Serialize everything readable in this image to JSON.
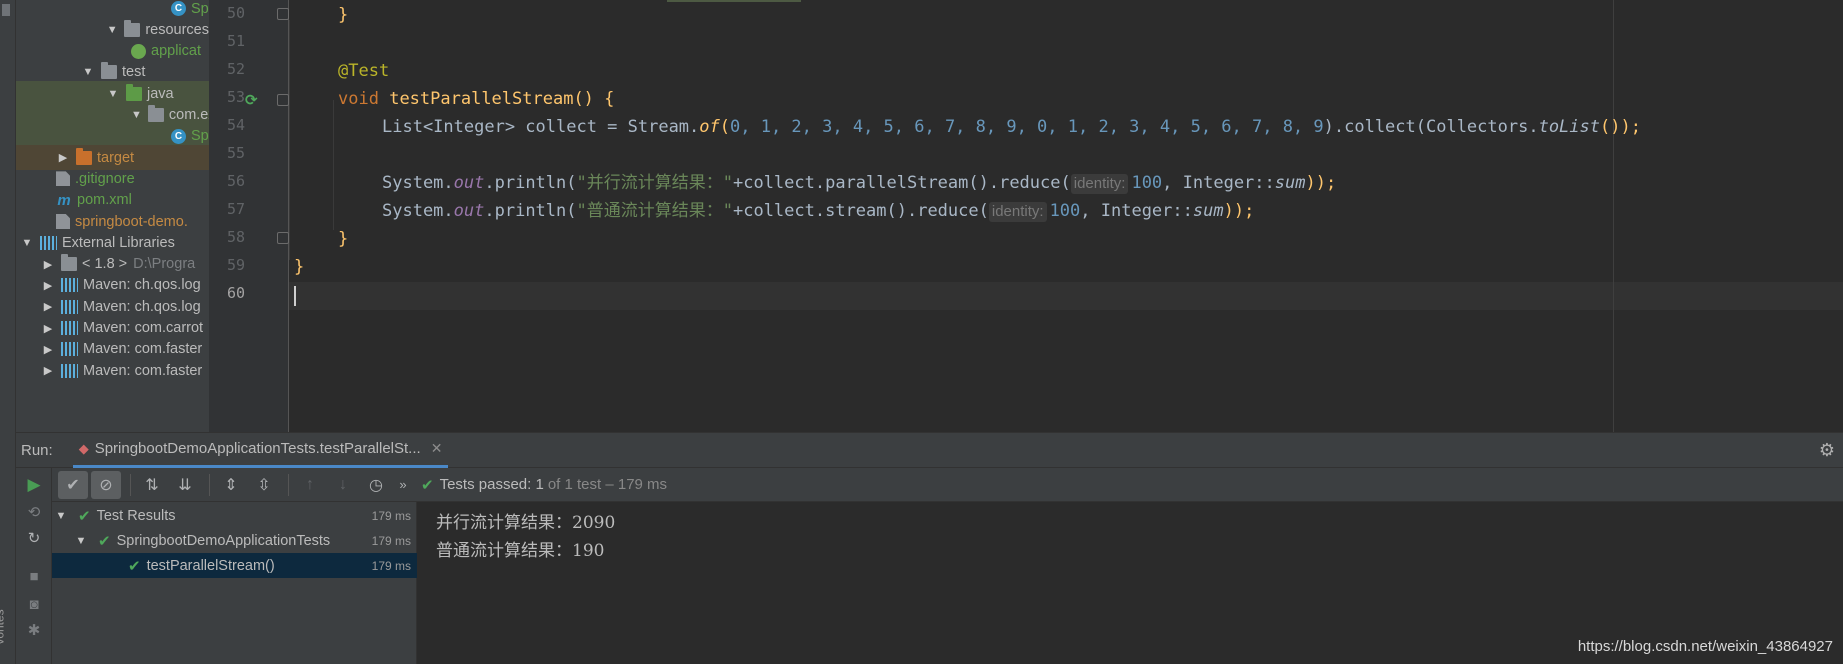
{
  "left_strip": {
    "favorites_label": "vorites"
  },
  "project_tree": [
    {
      "label": "Sprin",
      "icon": "spring-class-icon",
      "indent": 155,
      "color": "green"
    },
    {
      "label": "resources",
      "icon": "folder-icon",
      "indent": 90,
      "expanded": true
    },
    {
      "label": "applicat",
      "icon": "spring-config-icon",
      "indent": 115,
      "color": "green"
    },
    {
      "label": "test",
      "icon": "folder-icon",
      "indent": 65,
      "expanded": true
    },
    {
      "label": "java",
      "icon": "folder-icon",
      "indent": 90,
      "expanded": true,
      "highlight": "green"
    },
    {
      "label": "com.exa",
      "icon": "package-icon",
      "indent": 115,
      "expanded": true,
      "highlight": "green"
    },
    {
      "label": "Sprin",
      "icon": "spring-class-icon",
      "indent": 155,
      "color": "green",
      "highlight": "green"
    },
    {
      "label": "target",
      "icon": "folder-icon",
      "indent": 40,
      "expanded": false,
      "color": "orange",
      "highlight": "orange"
    },
    {
      "label": ".gitignore",
      "icon": "file-icon",
      "indent": 40,
      "color": "green"
    },
    {
      "label": "pom.xml",
      "icon": "maven-file-icon",
      "indent": 40,
      "color": "green"
    },
    {
      "label": "springboot-demo.",
      "icon": "file-icon",
      "indent": 40,
      "color": "orange"
    },
    {
      "label": "External Libraries",
      "icon": "library-icon",
      "indent": 4,
      "expanded": true
    },
    {
      "label": "< 1.8 >",
      "suffix": "D:\\Progra",
      "icon": "jdk-folder-icon",
      "indent": 25,
      "expanded": false
    },
    {
      "label": "Maven: ch.qos.log",
      "icon": "library-icon",
      "indent": 25,
      "expanded": false
    },
    {
      "label": "Maven: ch.qos.log",
      "icon": "library-icon",
      "indent": 25,
      "expanded": false
    },
    {
      "label": "Maven: com.carrot",
      "icon": "library-icon",
      "indent": 25,
      "expanded": false
    },
    {
      "label": "Maven: com.faster",
      "icon": "library-icon",
      "indent": 25,
      "expanded": false
    },
    {
      "label": "Maven: com.faster",
      "icon": "library-icon",
      "indent": 25,
      "expanded": false
    }
  ],
  "editor": {
    "line_numbers": [
      "50",
      "51",
      "52",
      "53",
      "54",
      "55",
      "56",
      "57",
      "58",
      "59",
      "60"
    ],
    "current_line": "60",
    "code": {
      "l50": "}",
      "l52": "@Test",
      "l53_void": "void",
      "l53_name": "testParallelStream",
      "l53_rest": "() {",
      "l54_a": "List<Integer> collect = Stream.",
      "l54_of": "of",
      "l54_nums": "0, 1, 2, 3, 4, 5, 6, 7, 8, 9, 0, 1, 2, 3, 4, 5, 6, 7, 8, 9",
      "l54_b": ").collect(Collectors.",
      "l54_tolist": "toList",
      "l54_c": "());",
      "l56_a": "System.",
      "l56_out": "out",
      "l56_b": ".println(",
      "l56_str": "\"并行流计算结果：\"",
      "l56_c": "+collect.parallelStream().reduce(",
      "l56_hint": "identity:",
      "l56_num": "100",
      "l56_d": ", Integer::",
      "l56_sum": "sum",
      "l56_e": "));",
      "l57_a": "System.",
      "l57_out": "out",
      "l57_b": ".println(",
      "l57_str": "\"普通流计算结果：\"",
      "l57_c": "+collect.stream().reduce(",
      "l57_hint": "identity:",
      "l57_num": "100",
      "l57_d": ", Integer::",
      "l57_sum": "sum",
      "l57_e": "));",
      "l58": "}",
      "l59": "}"
    }
  },
  "run": {
    "label": "Run:",
    "tab_title": "SpringbootDemoApplicationTests.testParallelSt...",
    "status": {
      "passed_text": "Tests passed:",
      "passed_count": "1",
      "detail": "of 1 test – 179 ms"
    },
    "results": [
      {
        "label": "Test Results",
        "time": "179 ms"
      },
      {
        "label": "SpringbootDemoApplicationTests",
        "time": "179 ms"
      },
      {
        "label": "testParallelStream()",
        "time": "179 ms",
        "selected": true
      }
    ],
    "console_lines": [
      "并行流计算结果：2090",
      "普通流计算结果：190"
    ]
  },
  "watermark": "https://blog.csdn.net/weixin_43864927",
  "colors": {
    "editor_bg": "#2b2b2b",
    "panel_bg": "#3c3f41",
    "keyword": "#cc7832",
    "annotation": "#bbb529",
    "method": "#ffc66d",
    "number": "#6897bb",
    "string": "#6a8759",
    "static_field": "#9876aa",
    "success": "#4fa85b",
    "selection": "#0d293e"
  }
}
